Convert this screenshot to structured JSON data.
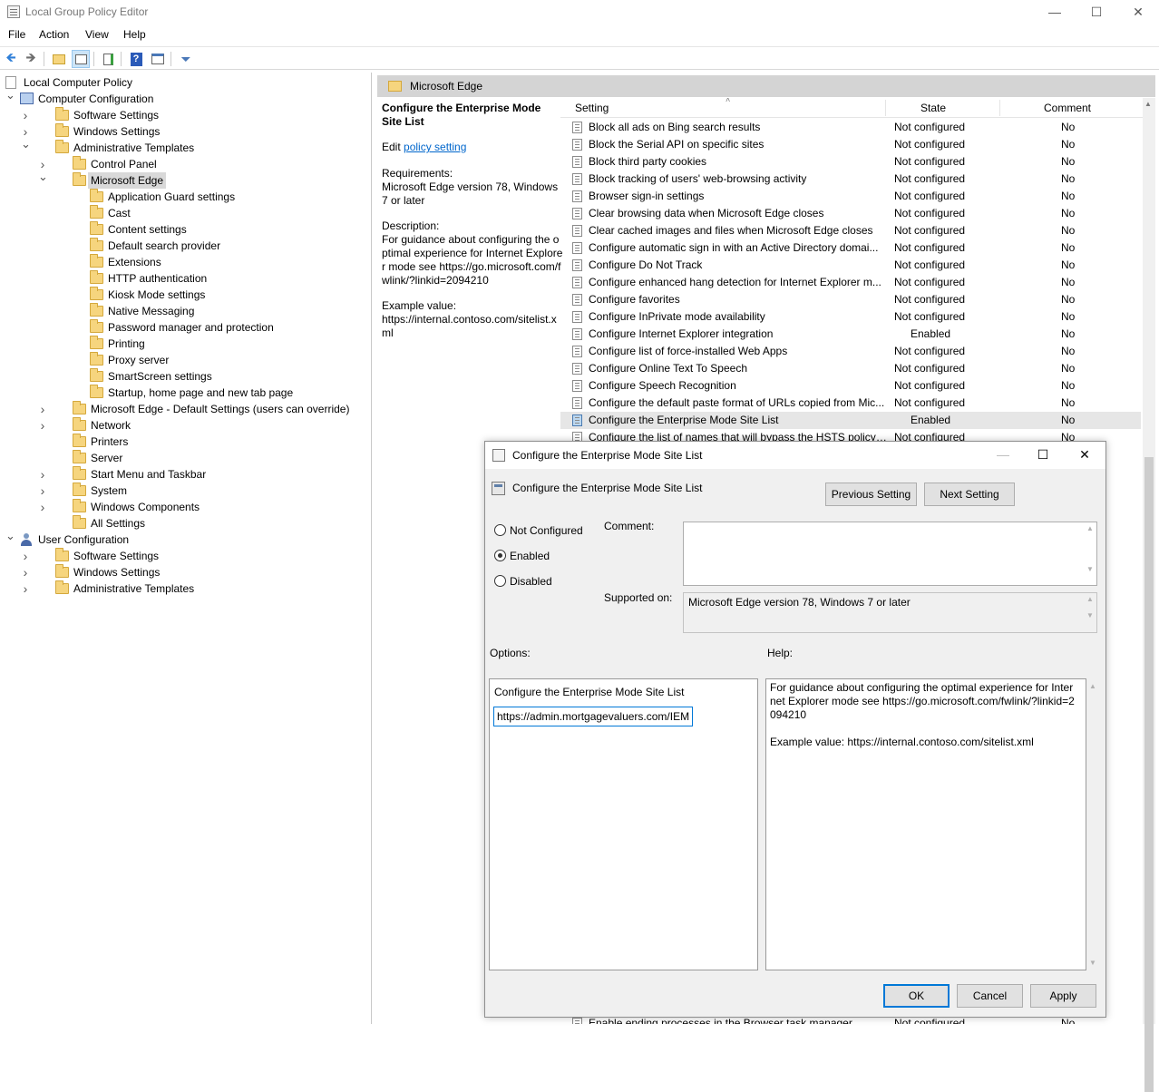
{
  "window": {
    "title": "Local Group Policy Editor",
    "minimize": "—",
    "maximize": "☐",
    "close": "✕"
  },
  "menu": [
    "File",
    "Action",
    "View",
    "Help"
  ],
  "toolbar_icons": [
    "back-icon",
    "forward-icon",
    "up-folder-icon",
    "show-hide-tree-icon",
    "export-list-icon",
    "help-icon",
    "properties-icon",
    "filter-icon"
  ],
  "tree": [
    {
      "label": "Local Computer Policy",
      "depth": 0,
      "icon": "doc",
      "chev": ""
    },
    {
      "label": "Computer Configuration",
      "depth": 0,
      "icon": "computer",
      "chev": "down"
    },
    {
      "label": "Software Settings",
      "depth": 1,
      "icon": "folder",
      "chev": "right"
    },
    {
      "label": "Windows Settings",
      "depth": 1,
      "icon": "folder",
      "chev": "right"
    },
    {
      "label": "Administrative Templates",
      "depth": 1,
      "icon": "folder",
      "chev": "down"
    },
    {
      "label": "Control Panel",
      "depth": 2,
      "icon": "folder",
      "chev": "right"
    },
    {
      "label": "Microsoft Edge",
      "depth": 2,
      "icon": "folder",
      "chev": "down",
      "selected": true
    },
    {
      "label": "Application Guard settings",
      "depth": 3,
      "icon": "folder",
      "chev": ""
    },
    {
      "label": "Cast",
      "depth": 3,
      "icon": "folder",
      "chev": ""
    },
    {
      "label": "Content settings",
      "depth": 3,
      "icon": "folder",
      "chev": ""
    },
    {
      "label": "Default search provider",
      "depth": 3,
      "icon": "folder",
      "chev": ""
    },
    {
      "label": "Extensions",
      "depth": 3,
      "icon": "folder",
      "chev": ""
    },
    {
      "label": "HTTP authentication",
      "depth": 3,
      "icon": "folder",
      "chev": ""
    },
    {
      "label": "Kiosk Mode settings",
      "depth": 3,
      "icon": "folder",
      "chev": ""
    },
    {
      "label": "Native Messaging",
      "depth": 3,
      "icon": "folder",
      "chev": ""
    },
    {
      "label": "Password manager and protection",
      "depth": 3,
      "icon": "folder",
      "chev": ""
    },
    {
      "label": "Printing",
      "depth": 3,
      "icon": "folder",
      "chev": ""
    },
    {
      "label": "Proxy server",
      "depth": 3,
      "icon": "folder",
      "chev": ""
    },
    {
      "label": "SmartScreen settings",
      "depth": 3,
      "icon": "folder",
      "chev": ""
    },
    {
      "label": "Startup, home page and new tab page",
      "depth": 3,
      "icon": "folder",
      "chev": ""
    },
    {
      "label": "Microsoft Edge - Default Settings (users can override)",
      "depth": 2,
      "icon": "folder",
      "chev": "right"
    },
    {
      "label": "Network",
      "depth": 2,
      "icon": "folder",
      "chev": "right"
    },
    {
      "label": "Printers",
      "depth": 2,
      "icon": "folder",
      "chev": ""
    },
    {
      "label": "Server",
      "depth": 2,
      "icon": "folder",
      "chev": ""
    },
    {
      "label": "Start Menu and Taskbar",
      "depth": 2,
      "icon": "folder",
      "chev": "right"
    },
    {
      "label": "System",
      "depth": 2,
      "icon": "folder",
      "chev": "right"
    },
    {
      "label": "Windows Components",
      "depth": 2,
      "icon": "folder",
      "chev": "right"
    },
    {
      "label": "All Settings",
      "depth": 2,
      "icon": "folder",
      "chev": ""
    },
    {
      "label": "User Configuration",
      "depth": 0,
      "icon": "user",
      "chev": "down"
    },
    {
      "label": "Software Settings",
      "depth": 1,
      "icon": "folder",
      "chev": "right"
    },
    {
      "label": "Windows Settings",
      "depth": 1,
      "icon": "folder",
      "chev": "right"
    },
    {
      "label": "Administrative Templates",
      "depth": 1,
      "icon": "folder",
      "chev": "right"
    }
  ],
  "right_pane": {
    "header": "Microsoft Edge",
    "desc_title": "Configure the Enterprise Mode Site List",
    "edit_prefix": "Edit ",
    "edit_link": "policy setting ",
    "requirements_label": "Requirements:",
    "requirements": "Microsoft Edge version 78, Windows 7 or later",
    "description_label": "Description:",
    "description": "For guidance about configuring the optimal experience for Internet Explorer mode see https://go.microsoft.com/fwlink/?linkid=2094210",
    "example_label": "Example value:",
    "example": "https://internal.contoso.com/sitelist.xml"
  },
  "list": {
    "columns": [
      "Setting",
      "State",
      "Comment"
    ],
    "rows": [
      {
        "name": "Block all ads on Bing search results",
        "state": "Not configured",
        "comment": "No"
      },
      {
        "name": "Block the Serial API on specific sites",
        "state": "Not configured",
        "comment": "No"
      },
      {
        "name": "Block third party cookies",
        "state": "Not configured",
        "comment": "No"
      },
      {
        "name": "Block tracking of users' web-browsing activity",
        "state": "Not configured",
        "comment": "No"
      },
      {
        "name": "Browser sign-in settings",
        "state": "Not configured",
        "comment": "No"
      },
      {
        "name": "Clear browsing data when Microsoft Edge closes",
        "state": "Not configured",
        "comment": "No"
      },
      {
        "name": "Clear cached images and files when Microsoft Edge closes",
        "state": "Not configured",
        "comment": "No"
      },
      {
        "name": "Configure automatic sign in with an Active Directory domai...",
        "state": "Not configured",
        "comment": "No"
      },
      {
        "name": "Configure Do Not Track",
        "state": "Not configured",
        "comment": "No"
      },
      {
        "name": "Configure enhanced hang detection for Internet Explorer m...",
        "state": "Not configured",
        "comment": "No"
      },
      {
        "name": "Configure favorites",
        "state": "Not configured",
        "comment": "No"
      },
      {
        "name": "Configure InPrivate mode availability",
        "state": "Not configured",
        "comment": "No"
      },
      {
        "name": "Configure Internet Explorer integration",
        "state": "Enabled",
        "comment": "No"
      },
      {
        "name": "Configure list of force-installed Web Apps",
        "state": "Not configured",
        "comment": "No"
      },
      {
        "name": "Configure Online Text To Speech",
        "state": "Not configured",
        "comment": "No"
      },
      {
        "name": "Configure Speech Recognition",
        "state": "Not configured",
        "comment": "No"
      },
      {
        "name": "Configure the default paste format of URLs copied from Mic...",
        "state": "Not configured",
        "comment": "No"
      },
      {
        "name": "Configure the Enterprise Mode Site List",
        "state": "Enabled",
        "comment": "No",
        "selected": true
      },
      {
        "name": "Configure the list of names that will bypass the HSTS policy ...",
        "state": "Not configured",
        "comment": "No"
      }
    ],
    "bottom_row": {
      "name": "Enable ending processes in the Browser task manager",
      "state": "Not configured",
      "comment": "No"
    }
  },
  "dialog": {
    "title": "Configure the Enterprise Mode Site List",
    "subtitle": "Configure the Enterprise Mode Site List",
    "previous": "Previous Setting",
    "next": "Next Setting",
    "radios": [
      {
        "label": "Not Configured",
        "checked": false
      },
      {
        "label": "Enabled",
        "checked": true
      },
      {
        "label": "Disabled",
        "checked": false
      }
    ],
    "comment_label": "Comment:",
    "comment_value": "",
    "supported_label": "Supported on:",
    "supported_value": "Microsoft Edge version 78, Windows 7 or later",
    "options_label": "Options:",
    "help_label": "Help:",
    "option_title": "Configure the Enterprise Mode Site List",
    "option_value": "https://admin.mortgagevaluers.com/IEM",
    "help_p1": "For guidance about configuring the optimal experience for Internet Explorer mode see https://go.microsoft.com/fwlink/?linkid=2094210",
    "help_p2": "Example value: https://internal.contoso.com/sitelist.xml",
    "ok": "OK",
    "cancel": "Cancel",
    "apply": "Apply"
  }
}
